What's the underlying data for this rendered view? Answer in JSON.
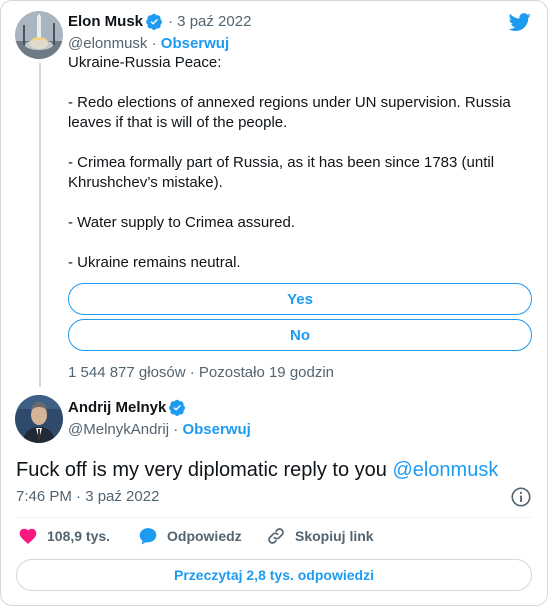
{
  "quoted_tweet": {
    "author_name": "Elon Musk",
    "date": "· 3 paź 2022",
    "handle": "@elonmusk",
    "follow_label": "Obserwuj",
    "text_lines": [
      "Ukraine-Russia Peace:",
      "- Redo elections of annexed regions under UN supervision. Russia leaves if that is will of the people.",
      "- Crimea formally part of Russia, as it has been since 1783 (until Khrushchev’s mistake).",
      "- Water supply to Crimea assured.",
      "- Ukraine remains neutral."
    ],
    "poll": {
      "options": [
        "Yes",
        "No"
      ],
      "meta": "1 544 877 głosów · Pozostało 19 godzin"
    }
  },
  "main_tweet": {
    "author_name": "Andrij Melnyk",
    "handle": "@MelnykAndrij",
    "follow_label": "Obserwuj",
    "text": "Fuck off is my very diplomatic reply to you ",
    "mention": "@elonmusk",
    "timestamp": "7:46 PM · 3 paź 2022"
  },
  "actions": {
    "likes": "108,9 tys.",
    "reply_label": "Odpowiedz",
    "copy_link_label": "Skopiuj link"
  },
  "read_replies_label": "Przeczytaj 2,8 tys. odpowiedzi",
  "colors": {
    "accent": "#1d9bf0",
    "like": "#f91880",
    "text_secondary": "#536471"
  },
  "icons": {
    "logo": "twitter-bird-icon",
    "verified": "verified-badge-icon",
    "info": "info-icon",
    "like": "heart-icon",
    "reply": "speech-bubble-icon",
    "copy_link": "link-icon"
  }
}
